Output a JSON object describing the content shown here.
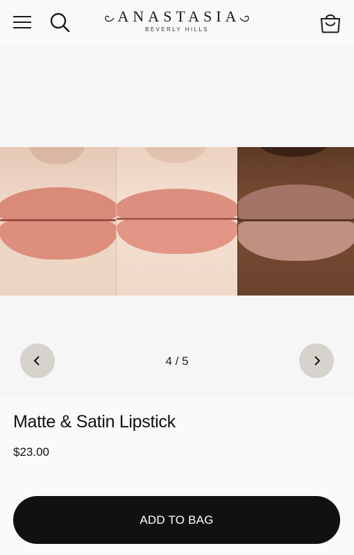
{
  "header": {
    "brand_name": "ANASTASIA",
    "brand_sub": "BEVERLY HILLS",
    "icons": {
      "menu": "hamburger-menu-icon",
      "search": "search-icon",
      "bag": "shopping-bag-icon"
    }
  },
  "gallery": {
    "counter": "4 / 5",
    "prev_icon": "chevron-left-icon",
    "next_icon": "chevron-right-icon"
  },
  "product": {
    "title": "Matte & Satin Lipstick",
    "price": "$23.00",
    "add_to_bag_label": "ADD TO BAG"
  },
  "colors": {
    "button_bg": "#111111",
    "slider_button_bg": "#d6d3cd",
    "page_bg": "#f7f7f7"
  }
}
